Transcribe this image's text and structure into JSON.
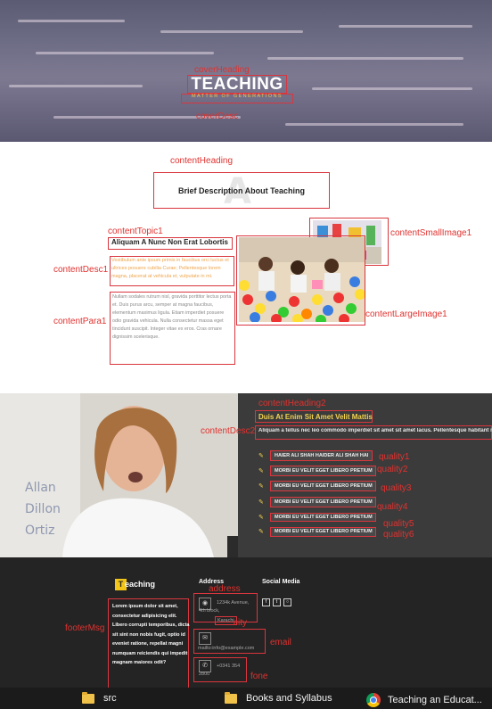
{
  "annotations": {
    "coverHeading": "coverHeading",
    "coverDesc": "coverDesc",
    "contentHeading": "contentHeading",
    "contentTopic1": "contentTopic1",
    "contentDesc1": "contentDesc1",
    "contentPara1": "contentPara1",
    "contentSmallImage1": "contentSmallImage1",
    "contentLargeImage1": "contentLargeImage1",
    "contentHeading2": "contentHeading2",
    "contentDesc2": "contentDesc2",
    "quality1": "quality1",
    "quality2": "quality2",
    "quality3": "quality3",
    "quality4": "quality4",
    "quality5": "quality5",
    "quality6": "quality6",
    "footerMsg": "footerMsg",
    "address": "address",
    "city": "city",
    "email": "email",
    "fone": "fone"
  },
  "cover": {
    "heading": "TEACHING",
    "desc": "MATTER OF GENERATIONS"
  },
  "content": {
    "ghost_letter": "A",
    "heading": "Brief Description About Teaching",
    "topic1": "Aliquam A Nunc Non Erat Lobortis",
    "desc1": "Vestibulum ante ipsum primis in faucibus orci luctus et ultrices posuere cubilia Curae; Pellentesque lorem magna, placerat at vehicula et, vulputate in mi.",
    "para1": "Nullam sodales rutrum nisl, gravida porttitor lectus porta et. Duis purus arcu, semper at magna faucibus, elementum maximus ligula. Etiam imperdiet posuere odio gravida vehicula. Nulla consectetur massa eget tincidunt suscipit. Integer vitae ex eros. Cras ornare dignissim scelerisque."
  },
  "qualities": {
    "heading2": "Duis At Enim Sit Amet Velit Mattis",
    "desc2": "Aliquam a tellus nec leo commodo imperdiet sit amet sit amet lacus. Pellentesque habitant morbi tristique",
    "items": [
      "HAIER ALI SHAH HAIDER ALI SHAH HAI",
      "MORBI EU VELIT EGET LIBERO PRETIUM",
      "MORBI EU VELIT EGET LIBERO PRETIUM",
      "MORBI EU VELIT EGET LIBERO PRETIUM",
      "MORBI EU VELIT EGET LIBERO PRETIUM",
      "MORBI EU VELIT EGET LIBERO PRETIUM"
    ]
  },
  "footer": {
    "logo_letter": "T",
    "logo_rest": "eaching",
    "message": "Lorem ipsum dolor sit amet, consectetur adipisicing elit. Libero corrupti temporibus, dicta sit sint non nobis fugit, optio id eveniet ratione, repellat magni numquam reiciendis qui impedit magnam maiores odit?",
    "address_title": "Address",
    "address_line": "1234k Avenue, 4th block,",
    "city": "Karachi",
    "email": "mailto:info@example.com",
    "phone": "+0341 354 2800",
    "social_title": "Social Media"
  },
  "taskbar": {
    "items": [
      "src",
      "Books and Syllabus",
      "Teaching an Educat..."
    ]
  },
  "colors": {
    "annotation": "#e0322f",
    "accent_yellow": "#f2d24f",
    "footer_bg": "#242424",
    "quality_bg": "#3c3b3b"
  },
  "icons": {
    "quality": "pencil-icon",
    "address": "map-pin-icon",
    "email": "envelope-icon",
    "phone": "phone-icon",
    "social": [
      "facebook-icon",
      "twitter-icon",
      "instagram-icon"
    ],
    "taskbar": [
      "folder-icon",
      "folder-icon",
      "chrome-icon"
    ]
  }
}
